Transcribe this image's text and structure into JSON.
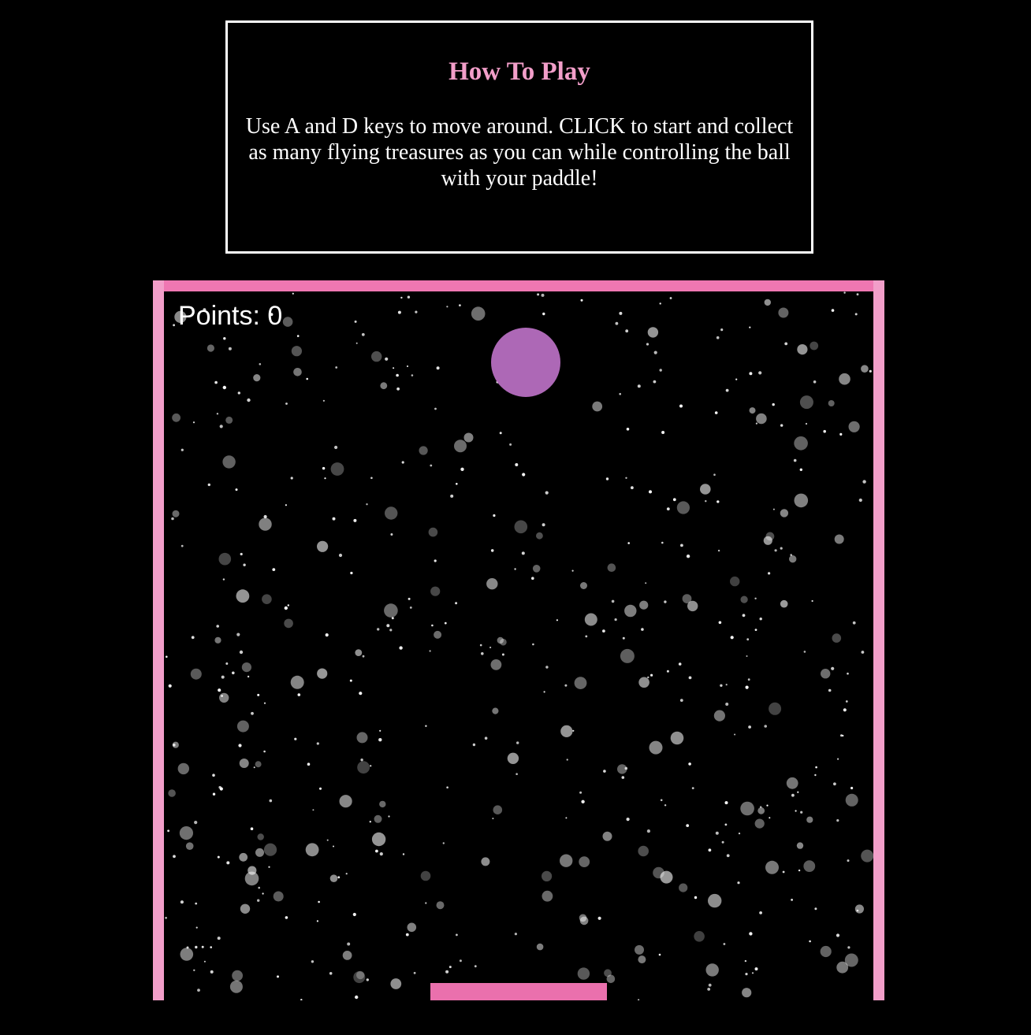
{
  "instructions": {
    "title": "How To Play",
    "body": "Use A and D keys to move around. CLICK to start and collect as many flying treasures as you can while controlling the ball with your paddle!"
  },
  "game": {
    "points_label": "Points:",
    "points_value": "0"
  },
  "colors": {
    "title": "#f29ec9",
    "wall": "#f29ec9",
    "ball": "#ad68b6",
    "paddle": "#ea70ad",
    "background": "#000000",
    "stars": "#ffffff"
  }
}
